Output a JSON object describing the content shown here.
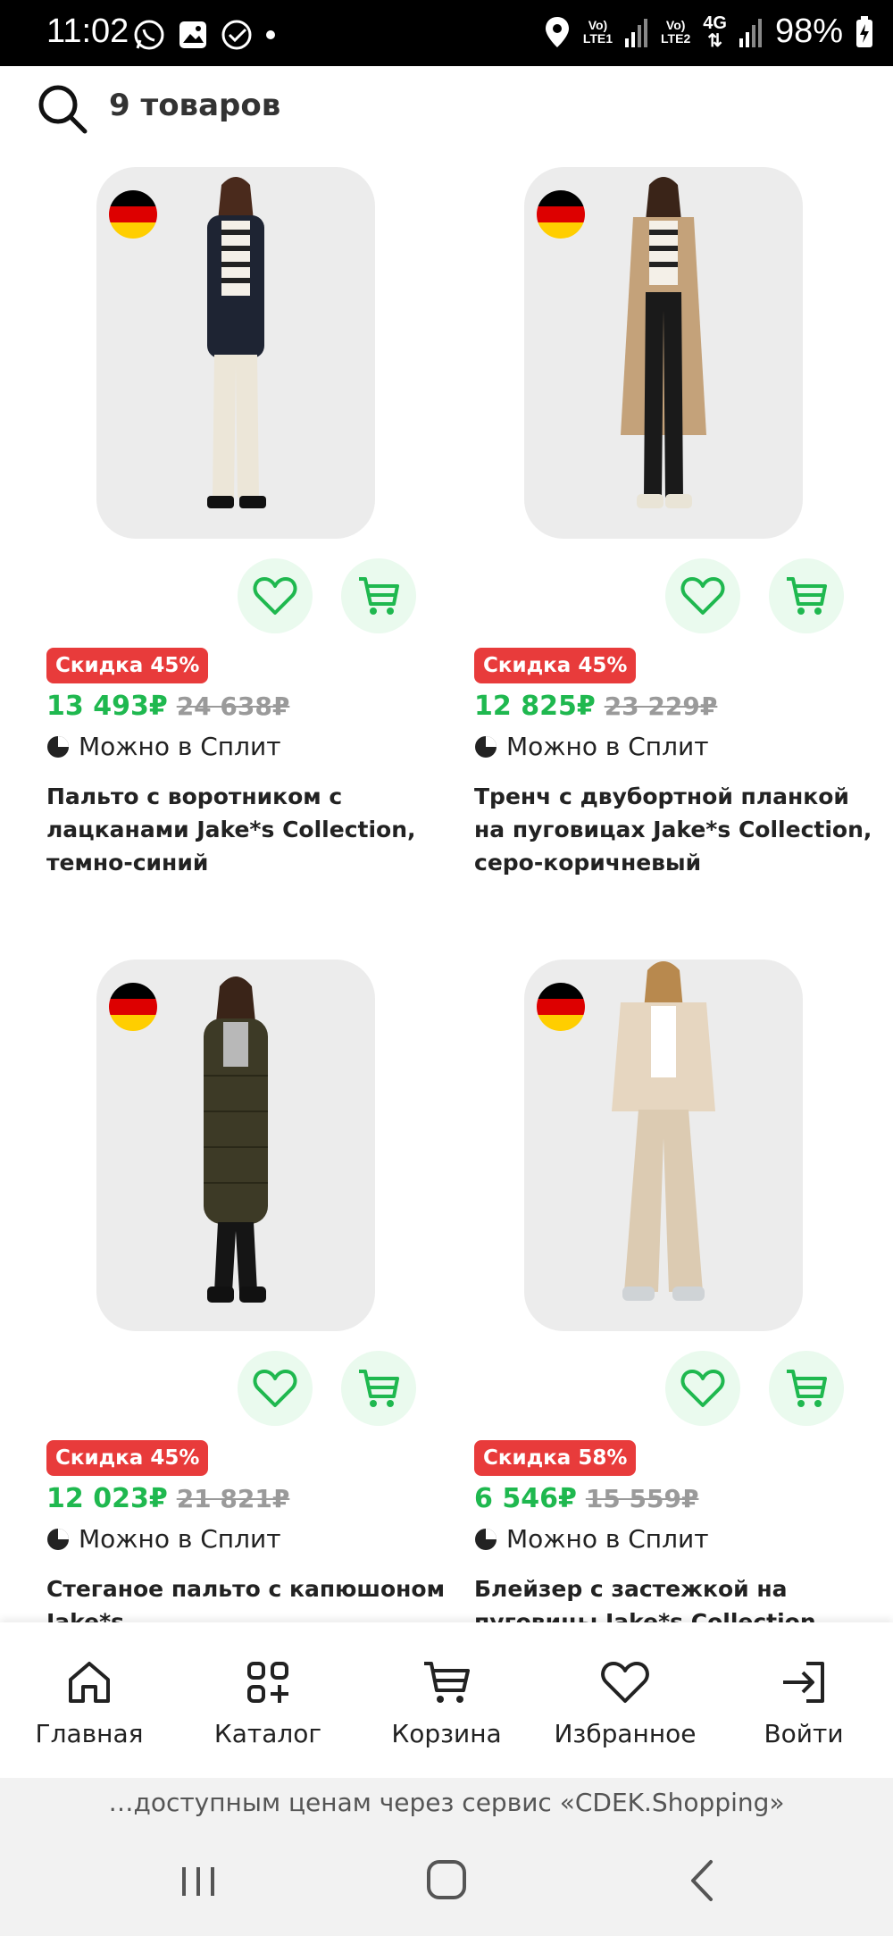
{
  "status_bar": {
    "time": "11:02",
    "network_1": [
      "Vo)",
      "LTE1"
    ],
    "network_2": [
      "Vo)",
      "LTE2"
    ],
    "network_gen": "4G",
    "battery": "98%"
  },
  "search": {
    "count_label": "9 товаров"
  },
  "products": [
    {
      "discount": "Скидка 45%",
      "price": "13 493₽",
      "old_price": "24 638₽",
      "split": "Можно в Сплит",
      "title": "Пальто с воротником с лацканами Jake*s Collection, темно-синий",
      "coat_color": "#1e2433",
      "pants_color": "#ece6d8"
    },
    {
      "discount": "Скидка 45%",
      "price": "12 825₽",
      "old_price": "23 229₽",
      "split": "Можно в Сплит",
      "title": "Тренч с двубортной планкой на пуговицах Jake*s Collection, серо-коричневый",
      "coat_color": "#c4a27a",
      "pants_color": "#1a1a1a"
    },
    {
      "discount": "Скидка 45%",
      "price": "12 023₽",
      "old_price": "21 821₽",
      "split": "Можно в Сплит",
      "title": "Стеганое пальто с капюшоном Jake*s",
      "coat_color": "#3d3a26",
      "pants_color": "#151515"
    },
    {
      "discount": "Скидка 58%",
      "price": "6 546₽",
      "old_price": "15 559₽",
      "split": "Можно в Сплит",
      "title": "Блейзер с застежкой на пуговицы Jake*s Collection",
      "coat_color": "#e6d6c0",
      "pants_color": "#dccbb2"
    }
  ],
  "tabs": [
    {
      "label": "Главная",
      "icon": "home-icon"
    },
    {
      "label": "Каталог",
      "icon": "catalog-icon"
    },
    {
      "label": "Корзина",
      "icon": "cart-icon"
    },
    {
      "label": "Избранное",
      "icon": "heart-icon"
    },
    {
      "label": "Войти",
      "icon": "login-icon"
    }
  ],
  "banner": "…доступным ценам через сервис «CDEK.Shopping»",
  "colors": {
    "accent_green": "#1fb84f",
    "discount_red": "#e83b3b",
    "icon_bg": "#eafaee"
  }
}
